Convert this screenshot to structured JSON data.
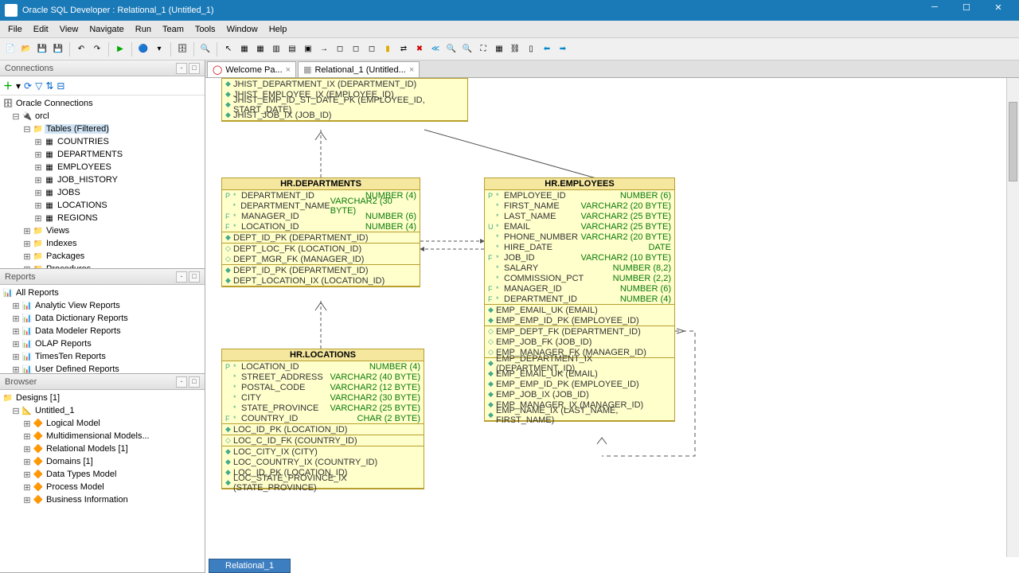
{
  "title": "Oracle SQL Developer : Relational_1 (Untitled_1)",
  "menu": [
    "File",
    "Edit",
    "View",
    "Navigate",
    "Run",
    "Team",
    "Tools",
    "Window",
    "Help"
  ],
  "panels": {
    "connections": "Connections",
    "reports": "Reports",
    "browser": "Browser"
  },
  "conn_root": "Oracle Connections",
  "conn_db": "orcl",
  "conn_tables_node": "Tables (Filtered)",
  "conn_tables": [
    "COUNTRIES",
    "DEPARTMENTS",
    "EMPLOYEES",
    "JOB_HISTORY",
    "JOBS",
    "LOCATIONS",
    "REGIONS"
  ],
  "conn_other": [
    "Views",
    "Indexes",
    "Packages",
    "Procedures"
  ],
  "reports_root": "All Reports",
  "reports": [
    "Analytic View Reports",
    "Data Dictionary Reports",
    "Data Modeler Reports",
    "OLAP Reports",
    "TimesTen Reports",
    "User Defined Reports"
  ],
  "browser_root": "Designs [1]",
  "browser_design": "Untitled_1",
  "browser_items": [
    "Logical Model",
    "Multidimensional Models...",
    "Relational Models [1]",
    "Domains [1]",
    "Data Types Model",
    "Process Model",
    "Business Information"
  ],
  "tabs": {
    "welcome": "Welcome Pa...",
    "relational": "Relational_1 (Untitled..."
  },
  "bottom_tab": "Relational_1",
  "jhist_idx": [
    "JHIST_DEPARTMENT_IX (DEPARTMENT_ID)",
    "JHIST_EMPLOYEE_IX (EMPLOYEE_ID)",
    "JHIST_EMP_ID_ST_DATE_PK (EMPLOYEE_ID, START_DATE)",
    "JHIST_JOB_IX (JOB_ID)"
  ],
  "dept": {
    "title": "HR.DEPARTMENTS",
    "cols": [
      {
        "k": "P",
        "n": "DEPARTMENT_ID",
        "t": "NUMBER (4)"
      },
      {
        "k": "",
        "n": "DEPARTMENT_NAME",
        "t": "VARCHAR2 (30 BYTE)"
      },
      {
        "k": "F",
        "n": "MANAGER_ID",
        "t": "NUMBER (6)"
      },
      {
        "k": "F",
        "n": "LOCATION_ID",
        "t": "NUMBER (4)"
      }
    ],
    "pk": [
      "DEPT_ID_PK (DEPARTMENT_ID)"
    ],
    "fk": [
      "DEPT_LOC_FK (LOCATION_ID)",
      "DEPT_MGR_FK (MANAGER_ID)"
    ],
    "ix": [
      "DEPT_ID_PK (DEPARTMENT_ID)",
      "DEPT_LOCATION_IX (LOCATION_ID)"
    ]
  },
  "emp": {
    "title": "HR.EMPLOYEES",
    "cols": [
      {
        "k": "P",
        "n": "EMPLOYEE_ID",
        "t": "NUMBER (6)"
      },
      {
        "k": "",
        "n": "FIRST_NAME",
        "t": "VARCHAR2 (20 BYTE)"
      },
      {
        "k": "",
        "n": "LAST_NAME",
        "t": "VARCHAR2 (25 BYTE)"
      },
      {
        "k": "U",
        "n": "EMAIL",
        "t": "VARCHAR2 (25 BYTE)"
      },
      {
        "k": "",
        "n": "PHONE_NUMBER",
        "t": "VARCHAR2 (20 BYTE)"
      },
      {
        "k": "",
        "n": "HIRE_DATE",
        "t": "DATE"
      },
      {
        "k": "F",
        "n": "JOB_ID",
        "t": "VARCHAR2 (10 BYTE)"
      },
      {
        "k": "",
        "n": "SALARY",
        "t": "NUMBER (8,2)"
      },
      {
        "k": "",
        "n": "COMMISSION_PCT",
        "t": "NUMBER (2,2)"
      },
      {
        "k": "F",
        "n": "MANAGER_ID",
        "t": "NUMBER (6)"
      },
      {
        "k": "F",
        "n": "DEPARTMENT_ID",
        "t": "NUMBER (4)"
      }
    ],
    "pk": [
      "EMP_EMAIL_UK (EMAIL)",
      "EMP_EMP_ID_PK (EMPLOYEE_ID)"
    ],
    "fk": [
      "EMP_DEPT_FK (DEPARTMENT_ID)",
      "EMP_JOB_FK (JOB_ID)",
      "EMP_MANAGER_FK (MANAGER_ID)"
    ],
    "ix": [
      "EMP_DEPARTMENT_IX (DEPARTMENT_ID)",
      "EMP_EMAIL_UK (EMAIL)",
      "EMP_EMP_ID_PK (EMPLOYEE_ID)",
      "EMP_JOB_IX (JOB_ID)",
      "EMP_MANAGER_IX (MANAGER_ID)",
      "EMP_NAME_IX (LAST_NAME, FIRST_NAME)"
    ]
  },
  "loc": {
    "title": "HR.LOCATIONS",
    "cols": [
      {
        "k": "P",
        "n": "LOCATION_ID",
        "t": "NUMBER (4)"
      },
      {
        "k": "",
        "n": "STREET_ADDRESS",
        "t": "VARCHAR2 (40 BYTE)"
      },
      {
        "k": "",
        "n": "POSTAL_CODE",
        "t": "VARCHAR2 (12 BYTE)"
      },
      {
        "k": "",
        "n": "CITY",
        "t": "VARCHAR2 (30 BYTE)"
      },
      {
        "k": "",
        "n": "STATE_PROVINCE",
        "t": "VARCHAR2 (25 BYTE)"
      },
      {
        "k": "F",
        "n": "COUNTRY_ID",
        "t": "CHAR (2 BYTE)"
      }
    ],
    "pk": [
      "LOC_ID_PK (LOCATION_ID)"
    ],
    "fk": [
      "LOC_C_ID_FK (COUNTRY_ID)"
    ],
    "ix": [
      "LOC_CITY_IX (CITY)",
      "LOC_COUNTRY_IX (COUNTRY_ID)",
      "LOC_ID_PK (LOCATION_ID)",
      "LOC_STATE_PROVINCE_IX (STATE_PROVINCE)"
    ]
  }
}
